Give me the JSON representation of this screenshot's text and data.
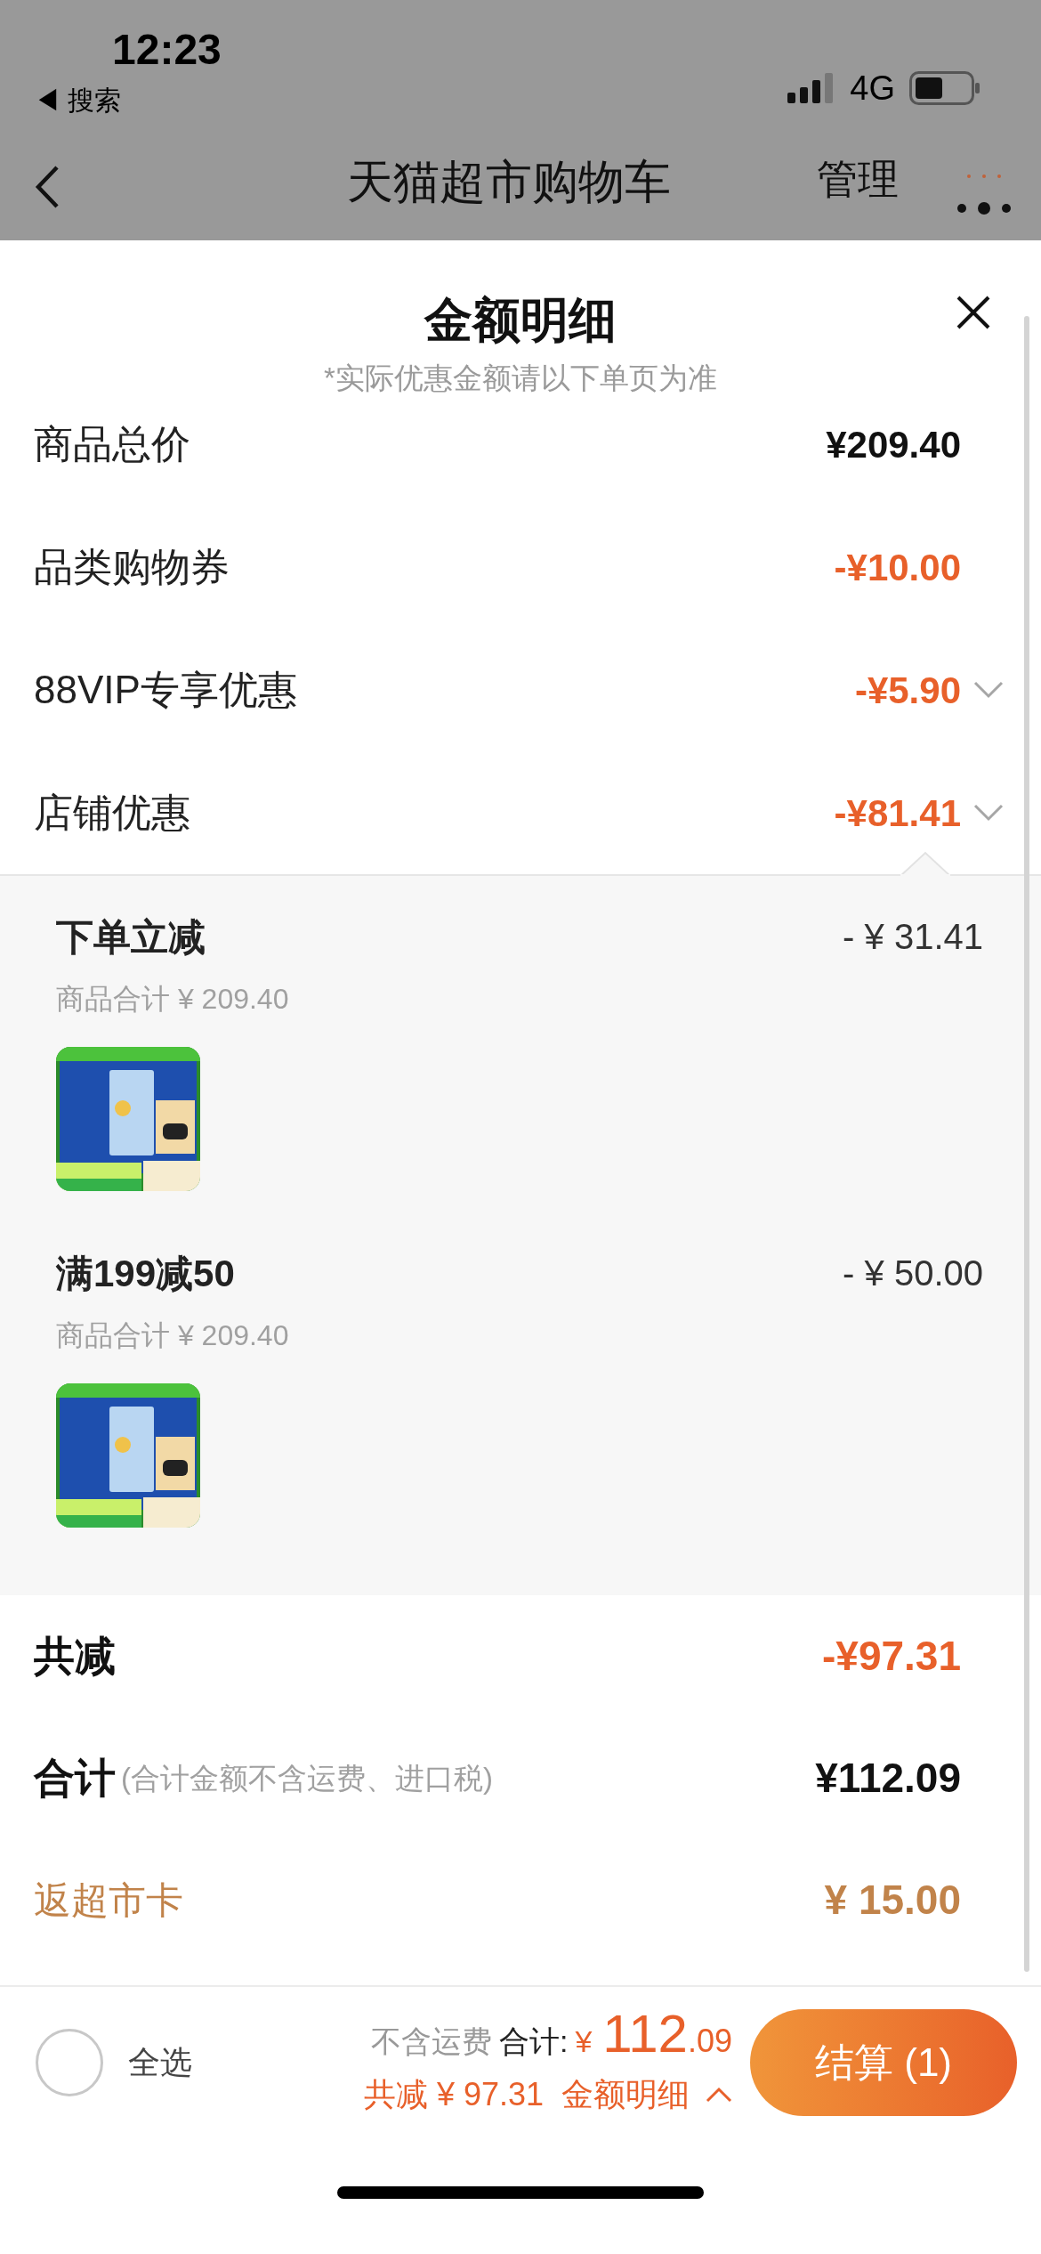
{
  "status_bar": {
    "time": "12:23",
    "back_label": "◀ 搜索",
    "network": "4G"
  },
  "nav": {
    "title": "天猫超市购物车",
    "action": "管理"
  },
  "sheet": {
    "title": "金额明细",
    "note": "*实际优惠金额请以下单页为准",
    "rows": [
      {
        "label": "商品总价",
        "value": "¥209.40",
        "kind": "price",
        "expandable": false,
        "expanded": false
      },
      {
        "label": "品类购物券",
        "value": "-¥10.00",
        "kind": "discount",
        "expandable": false,
        "expanded": false
      },
      {
        "label": "88VIP专享优惠",
        "value": "-¥5.90",
        "kind": "discount",
        "expandable": true,
        "expanded": false
      },
      {
        "label": "店铺优惠",
        "value": "-¥81.41",
        "kind": "discount",
        "expandable": true,
        "expanded": true
      }
    ],
    "details": [
      {
        "name": "下单立减",
        "amount": "- ¥ 31.41",
        "subtotal": "商品合计 ¥ 209.40"
      },
      {
        "name": "满199减50",
        "amount": "- ¥ 50.00",
        "subtotal": "商品合计 ¥ 209.40"
      }
    ],
    "summary": [
      {
        "label": "共减",
        "value": "-¥97.31",
        "kind": "discount"
      },
      {
        "label": "合计",
        "note": "(合计金额不含运费、进口税)",
        "value": "¥112.09",
        "kind": "price"
      },
      {
        "label": "返超市卡",
        "value": "¥ 15.00",
        "kind": "card"
      }
    ]
  },
  "bottom_bar": {
    "select_all": {
      "label": "全选",
      "checked": false
    },
    "shipping_note": "不含运费",
    "total_label": "合计:",
    "currency": "¥",
    "total_integer": "112",
    "total_decimal": ".09",
    "reduction": "共减 ¥ 97.31",
    "detail_link": "金额明细",
    "checkout": "结算 (1)"
  }
}
